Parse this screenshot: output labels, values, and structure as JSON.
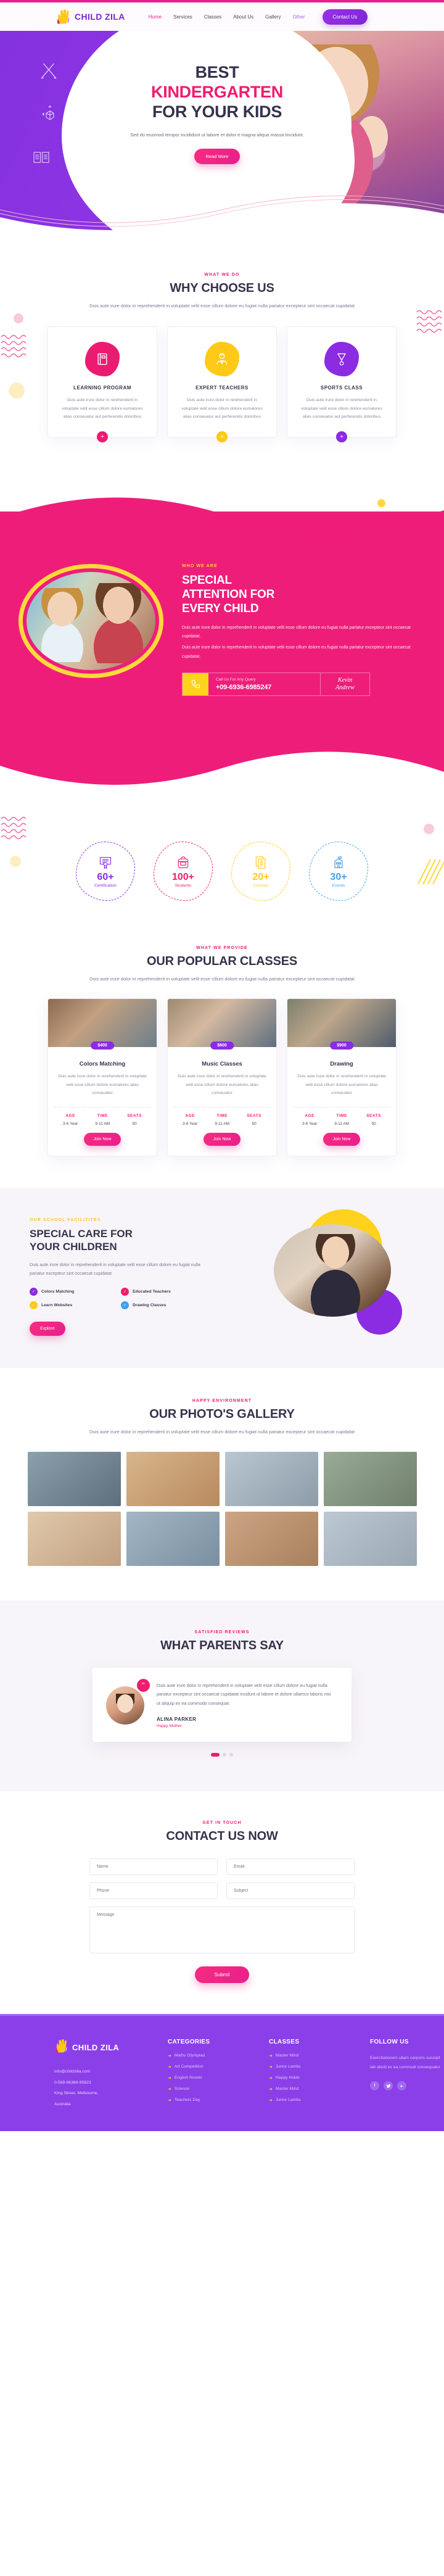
{
  "brand": {
    "name": "CHILD ZILA",
    "logo_icon": "hand-logo-icon"
  },
  "nav": {
    "items": [
      {
        "label": "Home",
        "state": "active"
      },
      {
        "label": "Services",
        "state": ""
      },
      {
        "label": "Classes",
        "state": ""
      },
      {
        "label": "About Us",
        "state": ""
      },
      {
        "label": "Gallery",
        "state": ""
      },
      {
        "label": "Other",
        "state": "other"
      }
    ],
    "cta": "Contact Us"
  },
  "hero": {
    "line1": "BEST",
    "line2": "KINDERGARTEN",
    "line3": "FOR YOUR KIDS",
    "sub": "Sed do eiusmod tempor incididunt ut labore et dolor e magna aliqua massa tincidunt.",
    "cta": "Read More"
  },
  "why": {
    "eyebrow": "WHAT WE DO",
    "title": "WHY CHOOSE US",
    "desc": "Duis aute irure dolor in reprehenderit in voluptate velit esse cillum dolore eu fugiat nulla pariatur excepteur sint occaecat cupidatat",
    "cards": [
      {
        "title": "LEARNING PROGRAM",
        "icon": "book-icon",
        "color": "#ec1b72",
        "text": "Duis aute irure dolor in rerehenderit in voluptate velit esse cillum dolore eumalores alias conseuatur aut perferendis doloribus"
      },
      {
        "title": "EXPERT TEACHERS",
        "icon": "teacher-icon",
        "color": "#ffc918",
        "text": "Duis aute irure dolor in rerehenderit in voluptate velit esse cillum dolore eumalores alias conseuatur aut perferendis doloribus"
      },
      {
        "title": "SPORTS CLASS",
        "icon": "medal-icon",
        "color": "#8b2be2",
        "text": "Duis aute irure dolor in rerehenderit in voluptate velit esse cillum dolore eumalores alias conseuatur aut perferendis doloribus"
      }
    ]
  },
  "attention": {
    "eyebrow": "WHO WE ARE",
    "title_l1": "SPECIAL",
    "title_l2": "ATTENTION FOR",
    "title_l3": "EVERY CHILD",
    "p1": "Duis aute irure dolor in reprehenderit in voluptate velit esse cillum dolore eu fugiat nulla pariatur excepteur sint occaecat cupidatat.",
    "p2": "Duis aute irure dolor in reprehenderit in voluptate velit esse cillum dolore eu fugiat nulla pariatur excepteur sint occaecat cupidatat.",
    "call_label": "Call Us For Any Query",
    "call_number": "+09-6936-6985247",
    "signature_l1": "Kevin",
    "signature_l2": "Andrew"
  },
  "stats": [
    {
      "num": "60+",
      "label": "Certification",
      "color": "#8b2be2",
      "icon": "certificate-icon"
    },
    {
      "num": "100+",
      "label": "Students",
      "color": "#ef1d6e",
      "icon": "backpack-icon"
    },
    {
      "num": "20+",
      "label": "Courses",
      "color": "#ffc918",
      "icon": "documents-icon"
    },
    {
      "num": "30+",
      "label": "Events",
      "color": "#3fa0f0",
      "icon": "school-icon"
    }
  ],
  "classes": {
    "eyebrow": "WHAT WE PROVIDE",
    "title": "OUR POPULAR CLASSES",
    "desc": "Duis aute irure dolor in reprehenderit in voluptate velit esse cillum dolore eu fugiat nulla pariatur excepteur sint occaecat cupidatat",
    "meta_headers": [
      "AGE",
      "TIME",
      "SEATS"
    ],
    "items": [
      {
        "price": "$400",
        "title": "Colors Matching",
        "text": "Duis aute irure dolor in rerehenderit in voluptate velit esse cillum dolore eumalores alias conseuatur",
        "age": "3-6 Year",
        "time": "9-11 AM",
        "seats": "50",
        "cta": "Join Now"
      },
      {
        "price": "$600",
        "title": "Music Classes",
        "text": "Duis aute irure dolor in rerehenderit in voluptate velit esse cillum dolore eumalores alias conseuatur",
        "age": "3-6 Year",
        "time": "9-11 AM",
        "seats": "50",
        "cta": "Join Now"
      },
      {
        "price": "$900",
        "title": "Drawing",
        "text": "Duis aute irure dolor in rerehenderit in voluptate velit esse cillum dolore eumalores alias conseuatur",
        "age": "3-6 Year",
        "time": "9-11 AM",
        "seats": "50",
        "cta": "Join Now"
      }
    ]
  },
  "care": {
    "eyebrow": "OUR SCHOOL FACILITITES",
    "title_l1": "SPECIAL CARE FOR",
    "title_l2": "YOUR CHILDREN",
    "desc": "Duis aute irure dolor in reprehenderit in voluptate velit esse cillum dolore eu fugiat nulla pariatur excepteur sint occaecat cupidatat",
    "features": [
      {
        "label": "Colors Matching",
        "color": "#8b2be2"
      },
      {
        "label": "Educated Teachers",
        "color": "#ef1d6e"
      },
      {
        "label": "Learn Websites",
        "color": "#ffc918"
      },
      {
        "label": "Drawing Classes",
        "color": "#3fa0f0"
      }
    ],
    "cta": "Explore"
  },
  "gallery": {
    "eyebrow": "HAPPY ENVIRONMENT",
    "title": "OUR PHOTO'S GALLERY",
    "desc": "Duis aute irure dolor in reprehenderit in voluptate velit esse cillum dolore eu fugiat nulla pariatur excepteur sint occaecat cupidatat",
    "tiles": [
      "#5e6e7c",
      "#b88a5e",
      "#8c9ca8",
      "#6f7f6c",
      "#c0a080",
      "#7a8fa0",
      "#a8805c",
      "#9aa8b4"
    ]
  },
  "testimonial": {
    "eyebrow": "SATISFIED REVIEWS",
    "title": "WHAT PARENTS SAY",
    "quote_mark": "“",
    "text": "Duis aute irure dolor in reprehenderit in voluptate velit esse cillum dolore eu fugiat nulla pariatur excepteur sint occaecat cupidatat incidunt ut labore et dolore ullamco laboris nisi ut aliquip ex ea commodo consequat.",
    "name": "ALINA PARKER",
    "role": "Happy Mother"
  },
  "contact": {
    "eyebrow": "GET IN TOUCH",
    "title": "CONTACT US NOW",
    "fields": {
      "name": "Name",
      "email": "Email",
      "phone": "Phone",
      "subject": "Subject",
      "message": "Message"
    },
    "submit": "Submit"
  },
  "footer": {
    "brand": "CHILD ZILA",
    "email": "info@childzilla.com",
    "phone": "0-589-96369-95823",
    "address_l1": "King Street, Melbourne,",
    "address_l2": "Australia",
    "categories_heading": "CATEGORIES",
    "categories": [
      "Maths Olympiad",
      "Art Competition",
      "English Novels",
      "Science",
      "Teachers Day"
    ],
    "classes_heading": "CLASSES",
    "classes": [
      "Master Mind",
      "Junior Lambs",
      "Happy Kiddo",
      "Master Mind",
      "Junior Lambs"
    ],
    "follow_heading": "FOLLOW US",
    "follow_text": "Exercitationem ullam corporis suscipit lab aliuid ex ea commodi consequatur",
    "socials": [
      "facebook-icon",
      "twitter-icon",
      "youtube-icon"
    ]
  }
}
